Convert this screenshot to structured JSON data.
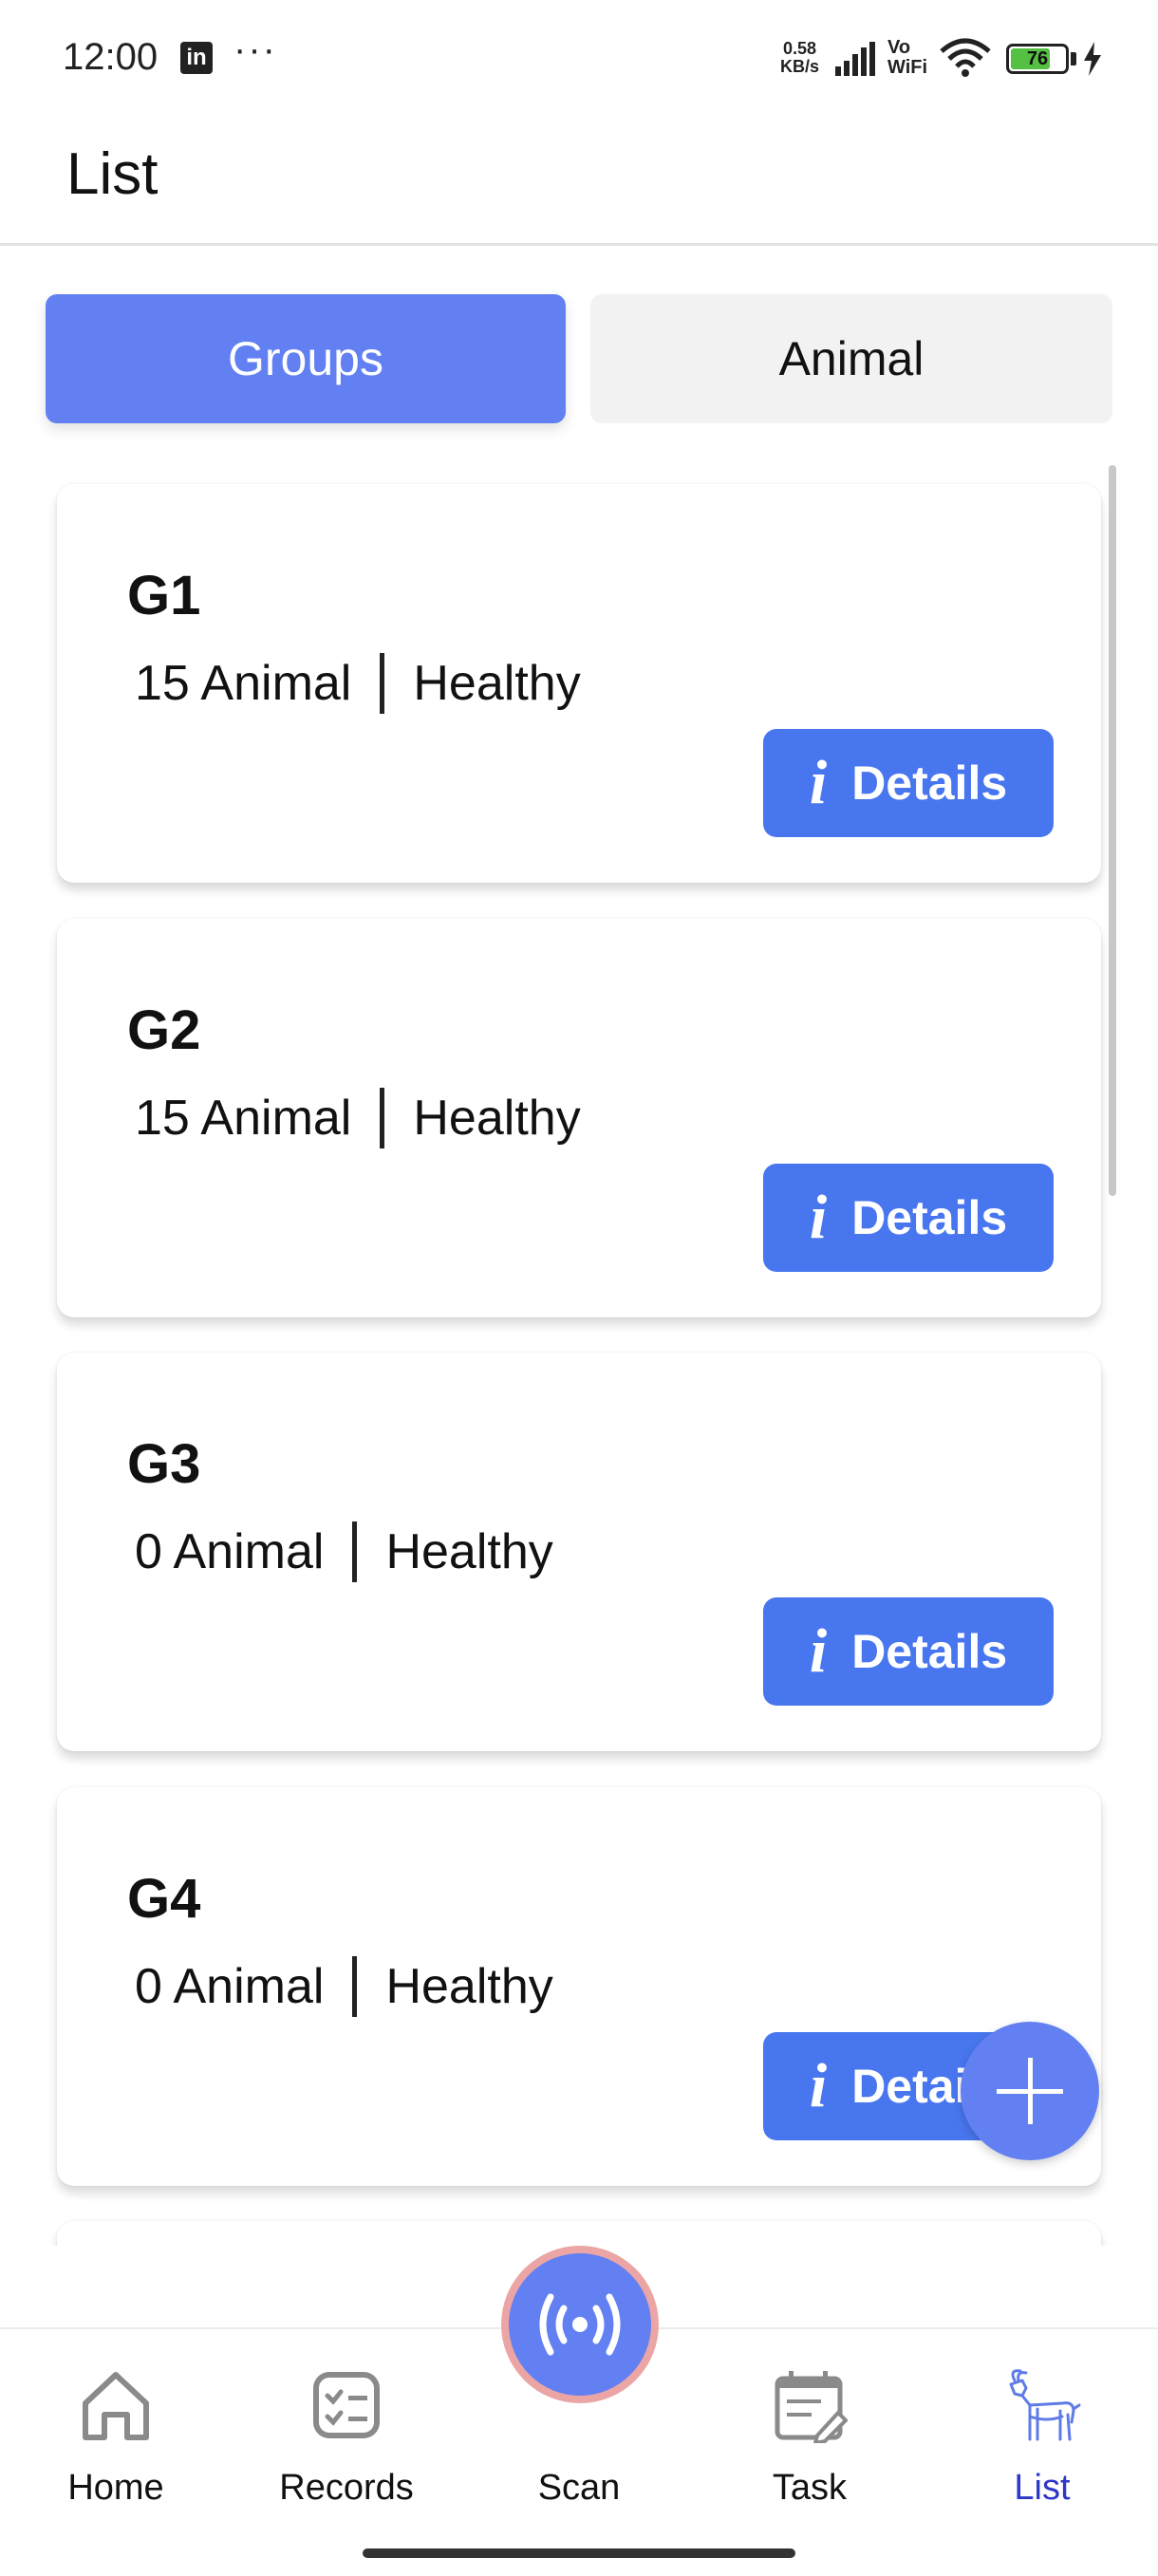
{
  "status_bar": {
    "time": "12:00",
    "app_icon": "LinkedIn",
    "more": "···",
    "net_speed_value": "0.58",
    "net_speed_unit": "KB/s",
    "vowifi_top": "Vo",
    "vowifi_bottom": "WiFi",
    "battery_level": "76",
    "battery_fraction": 0.76,
    "battery_color": "#55c142"
  },
  "header": {
    "title": "List"
  },
  "tabs": [
    {
      "label": "Groups",
      "selected": true
    },
    {
      "label": "Animal",
      "selected": false
    }
  ],
  "colors": {
    "accent": "#6280f2",
    "button": "#4876ef",
    "scan_ring": "#eca5a5"
  },
  "groups": [
    {
      "name": "G1",
      "count": "15 Animal",
      "status": "Healthy",
      "button_label": "Details"
    },
    {
      "name": "G2",
      "count": "15 Animal",
      "status": "Healthy",
      "button_label": "Details"
    },
    {
      "name": "G3",
      "count": "0 Animal",
      "status": "Healthy",
      "button_label": "Details"
    },
    {
      "name": "G4",
      "count": "0 Animal",
      "status": "Healthy",
      "button_label": "Details"
    }
  ],
  "fab": {
    "icon": "plus-icon"
  },
  "bottom_nav": {
    "items": [
      {
        "label": "Home",
        "icon": "home-icon"
      },
      {
        "label": "Records",
        "icon": "records-icon"
      },
      {
        "label": "Scan",
        "icon": "scan-icon"
      },
      {
        "label": "Task",
        "icon": "task-icon"
      },
      {
        "label": "List",
        "icon": "goat-icon",
        "active": true
      }
    ],
    "active_color": "#2e37c8"
  }
}
